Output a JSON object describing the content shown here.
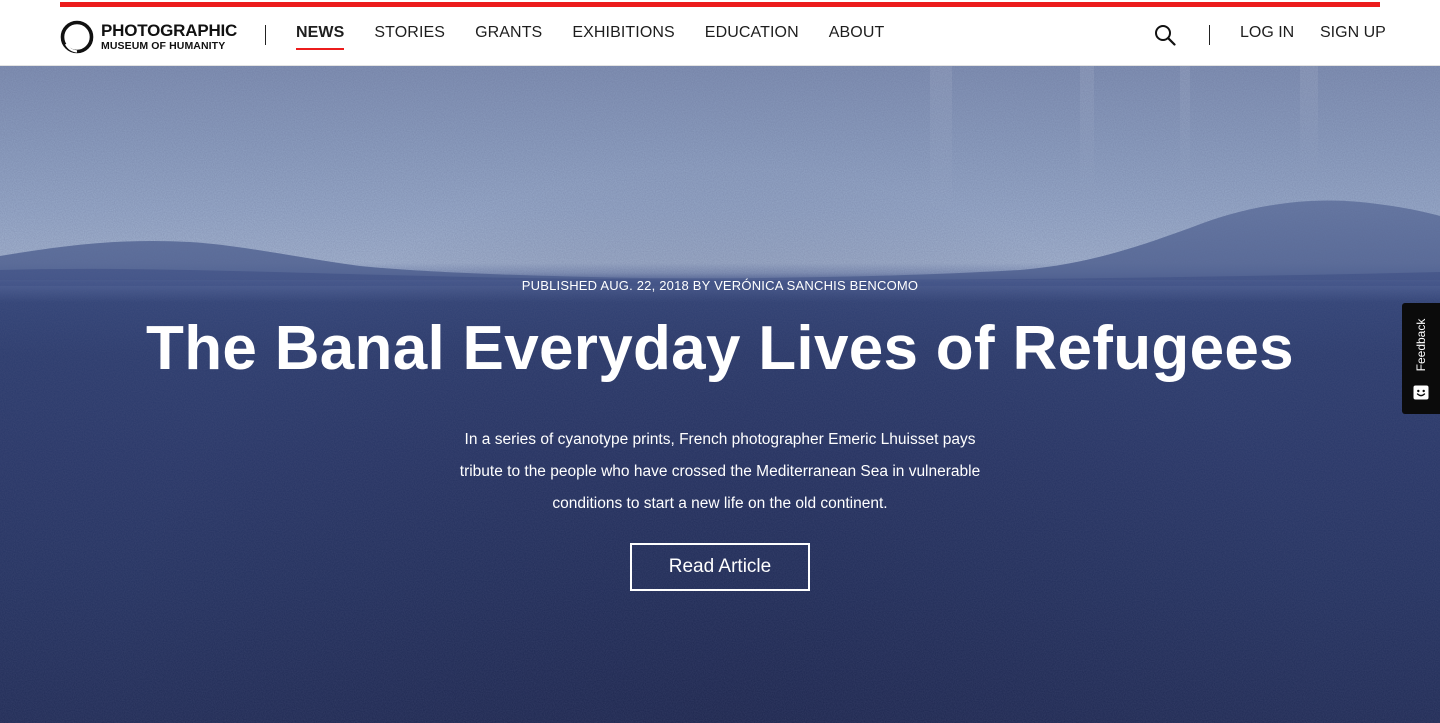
{
  "brand": {
    "line1": "PHOTOGRAPHIC",
    "line2": "MUSEUM OF HUMANITY"
  },
  "nav": {
    "items": [
      {
        "label": "NEWS",
        "active": true
      },
      {
        "label": "STORIES",
        "active": false
      },
      {
        "label": "GRANTS",
        "active": false
      },
      {
        "label": "EXHIBITIONS",
        "active": false
      },
      {
        "label": "EDUCATION",
        "active": false
      },
      {
        "label": "ABOUT",
        "active": false
      }
    ]
  },
  "header_actions": {
    "search_icon": "search-icon",
    "login_label": "LOG IN",
    "signup_label": "SIGN UP"
  },
  "hero": {
    "byline": "PUBLISHED AUG. 22, 2018 BY VERÓNICA SANCHIS BENCOMO",
    "title": "The Banal Everyday Lives of Refugees",
    "summary_lines": [
      "In a series of cyanotype prints, French photographer Emeric Lhuisset pays",
      "tribute to the people who have crossed the Mediterranean Sea in vulnerable",
      "conditions to start a new life on the old continent."
    ],
    "cta_label": "Read Article"
  },
  "feedback": {
    "label": "Feedback",
    "icon": "smiley-icon"
  },
  "colors": {
    "accent": "#ec1c1c",
    "header_bg": "#ffffff",
    "text_dark": "#1e1e1e",
    "hero_sea": "#283667",
    "hero_sky": "#9aaccb"
  }
}
